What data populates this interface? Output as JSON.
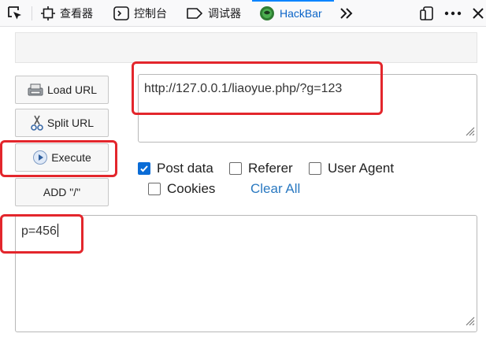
{
  "toolbar": {
    "tabs": [
      {
        "label": "查看器",
        "icon": "inspector-icon"
      },
      {
        "label": "控制台",
        "icon": "console-icon"
      },
      {
        "label": "调试器",
        "icon": "debugger-icon"
      },
      {
        "label": "HackBar",
        "icon": "hackbar-logo-icon",
        "active": true
      }
    ]
  },
  "buttons": {
    "load_url": "Load URL",
    "split_url": "Split URL",
    "execute": "Execute",
    "add_slash": "ADD \"/\""
  },
  "url_value": "http://127.0.0.1/liaoyue.php/?g=123",
  "options": {
    "post_data": {
      "label": "Post data",
      "checked": true
    },
    "referer": {
      "label": "Referer",
      "checked": false
    },
    "user_agent": {
      "label": "User Agent",
      "checked": false
    },
    "cookies": {
      "label": "Cookies",
      "checked": false
    },
    "clear_all": "Clear All"
  },
  "post_value": "p=456",
  "colors": {
    "accent": "#0a84ff",
    "highlight": "#e3262c",
    "link": "#2a79c1"
  }
}
